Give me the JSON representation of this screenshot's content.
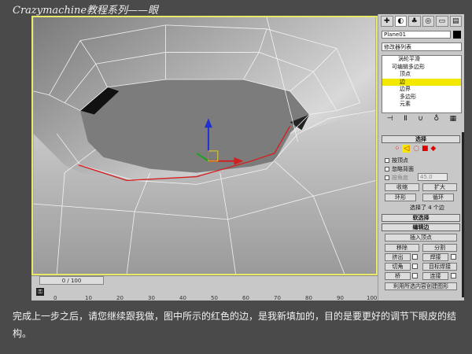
{
  "title": "Crazymachine教程系列——眼",
  "viewport": {
    "edge_color": "#d42020"
  },
  "timeline": {
    "frame": "0 / 100",
    "ticks": [
      "0",
      "10",
      "20",
      "30",
      "40",
      "50",
      "60",
      "70",
      "80",
      "90",
      "100"
    ]
  },
  "panel": {
    "tabs": [
      "create-icon",
      "modify-icon",
      "hierarchy-icon",
      "motion-icon",
      "display-icon",
      "utilities-icon"
    ],
    "object_name": "Plane01",
    "modifier_list": "修改器列表",
    "stack": [
      {
        "label": "涡轮平滑"
      },
      {
        "label": "可编辑多边形"
      },
      {
        "label": "顶点"
      },
      {
        "label": "边"
      },
      {
        "label": "边界"
      },
      {
        "label": "多边形"
      },
      {
        "label": "元素"
      }
    ],
    "selection": {
      "title": "选择",
      "by_vertex": "按顶点",
      "ignore_backfacing": "忽略背面",
      "by_angle": "按角度",
      "angle_value": "45.0",
      "shrink": "收缩",
      "grow": "扩大",
      "ring": "环形",
      "loop": "循环",
      "status": "选择了 4 个边"
    },
    "soft_selection": "软选择",
    "edit_edges": {
      "title": "编辑边",
      "insert_vertex": "插入顶点",
      "remove": "移除",
      "split": "分割",
      "extrude": "挤出",
      "weld": "焊接",
      "chamfer": "切角",
      "target_weld": "目标焊接",
      "bridge": "桥",
      "connect": "连接",
      "create_shape": "利用所选内容创建图形"
    }
  },
  "caption": "完成上一步之后，请您继续跟我做，图中所示的红色的边，是我新填加的，目的是要更好的调节下眼皮的结构。"
}
